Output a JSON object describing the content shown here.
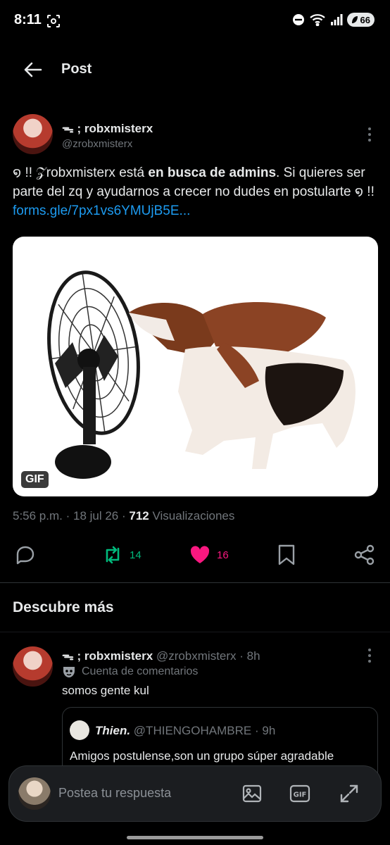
{
  "status_bar": {
    "time": "8:11",
    "battery": "66"
  },
  "header": {
    "title": "Post"
  },
  "post": {
    "display_name": "ᯓ ; robxmisterx",
    "handle": "@zrobxmisterx",
    "text_part1": "໑ !!          𝒵robxmisterx está ",
    "text_bold": "en busca de admins",
    "text_part2": ". Si quieres ser parte del zq y ayudarnos a crecer no dudes en postularte ໑ !! ",
    "link": "forms.gle/7px1vs6YMUjB5E...",
    "media_badge": "GIF",
    "time": "5:56 p.m.",
    "date": "18 jul 26",
    "views_count": "712",
    "views_label": "Visualizaciones",
    "retweets": "14",
    "likes": "16",
    "colors": {
      "retweet": "#00ba7c",
      "like": "#f91880",
      "link": "#1d9bf0"
    }
  },
  "discover": {
    "title": "Descubre más",
    "item": {
      "display_name": "ᯓ ; robxmisterx",
      "handle": "@zrobxmisterx",
      "age": "8h",
      "account_type": "Cuenta de comentarios",
      "text": "somos gente kul",
      "quote": {
        "display_name": "Thien.",
        "handle": "@THIENGOHAMBRE",
        "age": "9h",
        "text": "Amigos postulense,son un grupo súper agradable"
      }
    }
  },
  "reply": {
    "placeholder": "Postea tu respuesta"
  }
}
